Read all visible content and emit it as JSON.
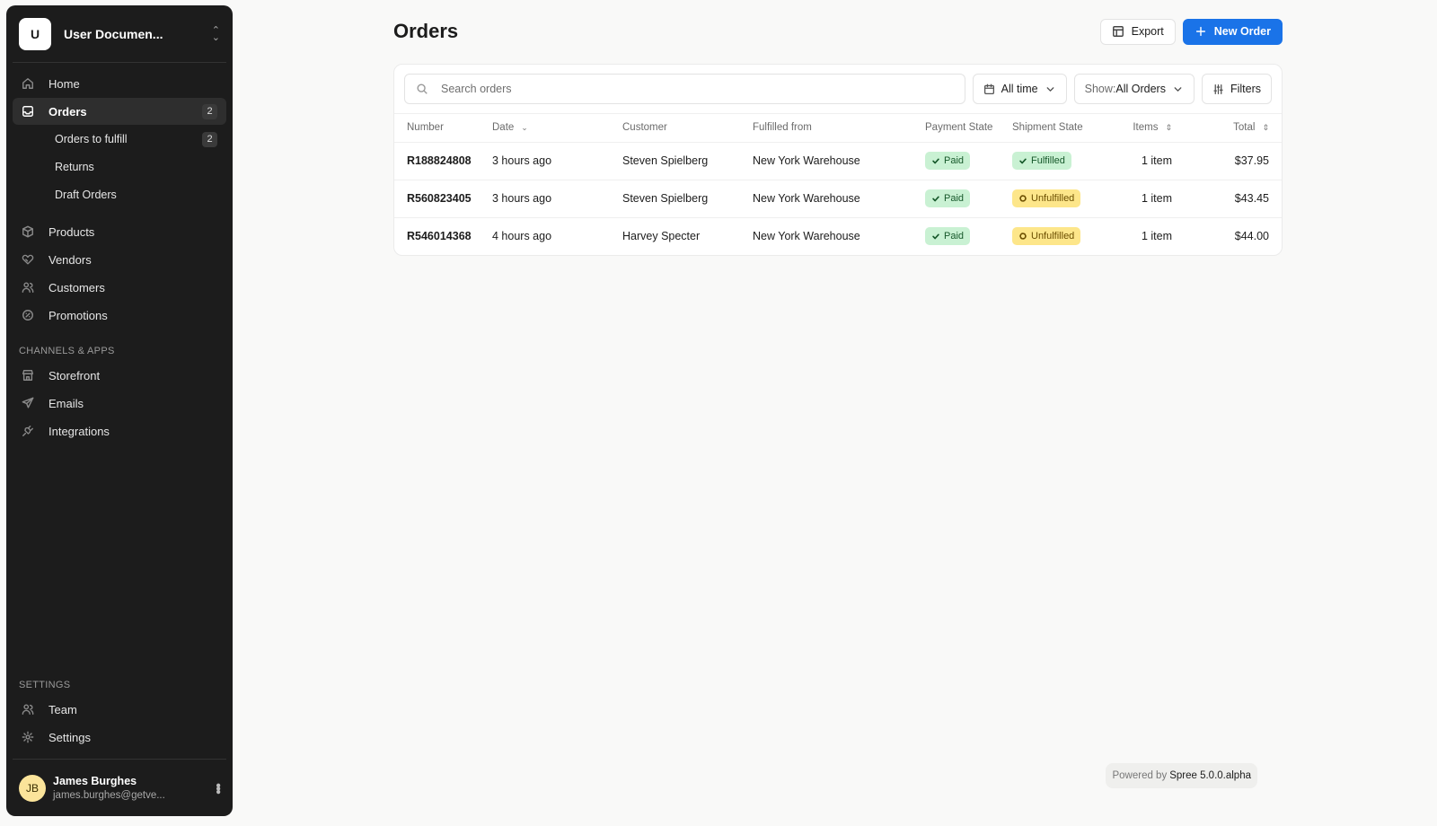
{
  "store": {
    "initial": "U",
    "name": "User Documen..."
  },
  "nav": {
    "home": "Home",
    "orders": "Orders",
    "orders_count": "2",
    "orders_to_fulfill": "Orders to fulfill",
    "orders_to_fulfill_count": "2",
    "returns": "Returns",
    "draft_orders": "Draft Orders",
    "products": "Products",
    "vendors": "Vendors",
    "customers": "Customers",
    "promotions": "Promotions"
  },
  "channels": {
    "title": "CHANNELS & APPS",
    "storefront": "Storefront",
    "emails": "Emails",
    "integrations": "Integrations"
  },
  "settings": {
    "title": "SETTINGS",
    "team": "Team",
    "settings": "Settings"
  },
  "user": {
    "initials": "JB",
    "name": "James Burghes",
    "email": "james.burghes@getve..."
  },
  "header": {
    "title": "Orders",
    "export_label": "Export",
    "new_order_label": "New Order"
  },
  "toolbar": {
    "search_placeholder": "Search orders",
    "date_filter": "All time",
    "show_prefix": "Show:",
    "show_value": "All Orders",
    "filters_label": "Filters"
  },
  "table": {
    "columns": {
      "number": "Number",
      "date": "Date",
      "customer": "Customer",
      "fulfilled_from": "Fulfilled from",
      "payment_state": "Payment State",
      "shipment_state": "Shipment State",
      "items": "Items",
      "total": "Total"
    },
    "rows": [
      {
        "number": "R188824808",
        "date": "3 hours ago",
        "customer": "Steven Spielberg",
        "fulfilled_from": "New York Warehouse",
        "payment": "Paid",
        "shipment": "Fulfilled",
        "items": "1 item",
        "total": "$37.95"
      },
      {
        "number": "R560823405",
        "date": "3 hours ago",
        "customer": "Steven Spielberg",
        "fulfilled_from": "New York Warehouse",
        "payment": "Paid",
        "shipment": "Unfulfilled",
        "items": "1 item",
        "total": "$43.45"
      },
      {
        "number": "R546014368",
        "date": "4 hours ago",
        "customer": "Harvey Specter",
        "fulfilled_from": "New York Warehouse",
        "payment": "Paid",
        "shipment": "Unfulfilled",
        "items": "1 item",
        "total": "$44.00"
      }
    ]
  },
  "footer": {
    "prefix": "Powered by",
    "brand": "Spree 5.0.0.alpha"
  },
  "colors": {
    "primary": "#1a73e8",
    "sidebar_bg": "#1c1c1c",
    "paid_bg": "#c9f1d3",
    "unfulfilled_bg": "#fde68a"
  }
}
